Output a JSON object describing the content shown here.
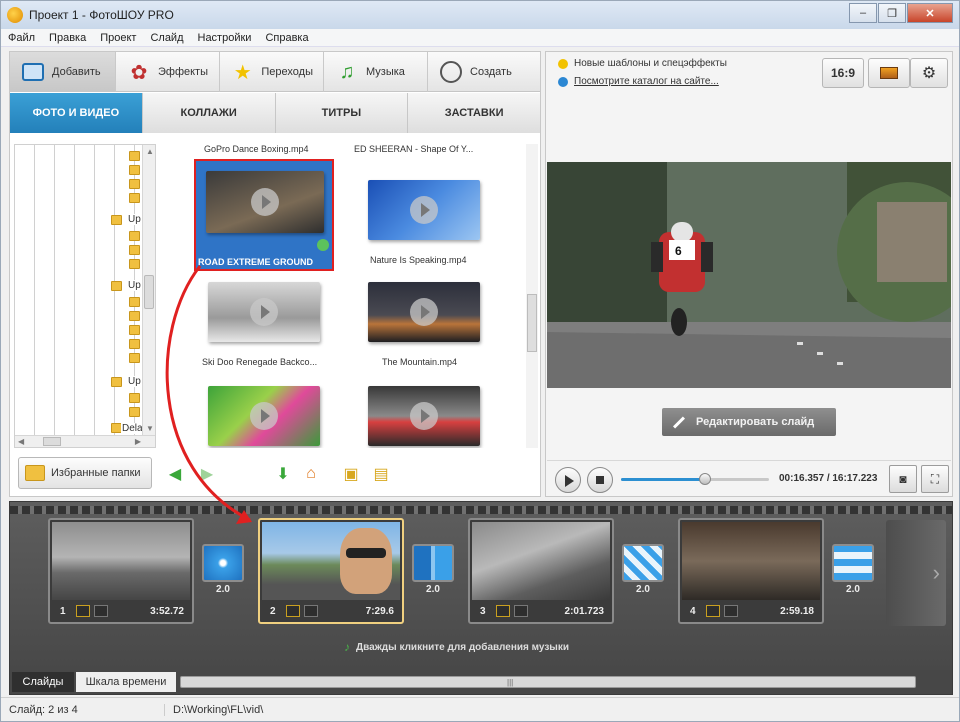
{
  "window": {
    "title": "Проект 1 - ФотоШОУ PRO",
    "controls": [
      "–",
      "❐",
      "✕"
    ]
  },
  "menu": [
    "Файл",
    "Правка",
    "Проект",
    "Слайд",
    "Настройки",
    "Справка"
  ],
  "main_tabs": [
    {
      "label": "Добавить",
      "icon": "add-photo-icon",
      "active": true
    },
    {
      "label": "Эффекты",
      "icon": "palette-icon"
    },
    {
      "label": "Переходы",
      "icon": "star-icon"
    },
    {
      "label": "Музыка",
      "icon": "music-note-icon"
    },
    {
      "label": "Создать",
      "icon": "disc-icon"
    }
  ],
  "sub_tabs": [
    {
      "label": "ФОТО И ВИДЕО",
      "active": true
    },
    {
      "label": "КОЛЛАЖИ"
    },
    {
      "label": "ТИТРЫ"
    },
    {
      "label": "ЗАСТАВКИ"
    }
  ],
  "tree": {
    "nodes": [
      "Up",
      "Up",
      "Up",
      "Delad"
    ]
  },
  "media": {
    "top_captions": [
      "GoPro Dance Boxing.mp4",
      "ED SHEERAN - Shape Of Y..."
    ],
    "items": [
      {
        "caption": "ROAD EXTREME GROUND",
        "selected": true
      },
      {
        "caption": "Nature Is Speaking.mp4"
      },
      {
        "caption": "Ski Doo Renegade Backco..."
      },
      {
        "caption": "The Mountain.mp4"
      },
      {
        "caption": ""
      },
      {
        "caption": ""
      }
    ]
  },
  "left_toolbar": {
    "favorites_label": "Избранные папки",
    "icons": [
      "back-arrow-icon",
      "forward-arrow-icon",
      "add-down-icon",
      "home-icon",
      "add-folder-icon",
      "add-all-icon"
    ]
  },
  "right_panel": {
    "news": [
      {
        "text": "Новые шаблоны и спецэффекты",
        "dot": "#f2c200"
      },
      {
        "text": "Посмотрите каталог на сайте...",
        "dot": "#2b87d3",
        "link": true
      }
    ],
    "aspect_label": "16:9",
    "edit_slide_label": "Редактировать слайд",
    "player": {
      "time": "00:16.357 / 16:17.223",
      "progress": 0.57
    }
  },
  "storyboard": {
    "slides": [
      {
        "num": "1",
        "duration": "3:52.72",
        "selected": false
      },
      {
        "num": "2",
        "duration": "7:29.6",
        "selected": true
      },
      {
        "num": "3",
        "duration": "2:01.723",
        "selected": false
      },
      {
        "num": "4",
        "duration": "2:59.18",
        "selected": false
      }
    ],
    "transitions": [
      "2.0",
      "2.0",
      "2.0",
      "2.0"
    ],
    "music_hint": "Дважды кликните для добавления музыки",
    "bottom_tabs": [
      "Слайды",
      "Шкала времени"
    ]
  },
  "status": {
    "slide": "Слайд: 2 из 4",
    "path": "D:\\Working\\FL\\vid\\"
  }
}
